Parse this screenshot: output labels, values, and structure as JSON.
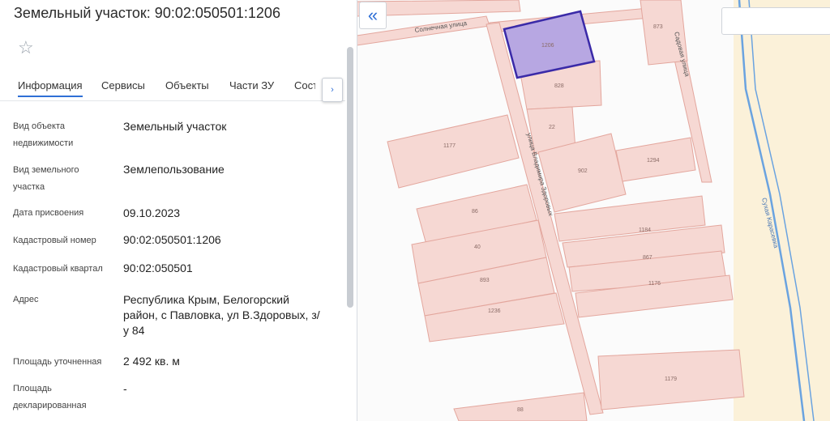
{
  "panel": {
    "title": "Земельный участок: 90:02:050501:1206",
    "star": "☆",
    "tabs": [
      "Информация",
      "Сервисы",
      "Объекты",
      "Части ЗУ",
      "Соста"
    ],
    "tab_scroll_icon": "›",
    "fields": [
      {
        "label": [
          "Вид объекта",
          "недвижимости"
        ],
        "value": [
          "Земельный участок"
        ]
      },
      {
        "label": [
          "Вид земельного",
          "участка"
        ],
        "value": [
          "Землепользование"
        ]
      },
      {
        "label": [
          "Дата присвоения"
        ],
        "value": [
          "09.10.2023"
        ]
      },
      {
        "label": [
          "Кадастровый номер"
        ],
        "value": [
          "90:02:050501:1206"
        ]
      },
      {
        "label": [
          "Кадастровый квартал"
        ],
        "value": [
          "90:02:050501"
        ]
      },
      {
        "label": [
          "Адрес"
        ],
        "value": [
          "Республика Крым, Белогорский",
          "район, с Павловка, ул В.Здоровых, з/",
          "у 84"
        ]
      },
      {
        "label": [
          "Площадь уточненная"
        ],
        "value": [
          "2 492 кв. м"
        ]
      },
      {
        "label": [
          "Площадь",
          "декларированная"
        ],
        "value": [
          "-"
        ]
      }
    ]
  },
  "map": {
    "collapse_icon": "«",
    "streets": [
      "Солнечная улица",
      "Садовая улица",
      "улица Владимира Здоровых",
      "Сухая Карасевка"
    ],
    "parcels": [
      "1206",
      "828",
      "873",
      "22",
      "1177",
      "902",
      "1294",
      "86",
      "1184",
      "40",
      "867",
      "893",
      "1176",
      "1236",
      "1179",
      "88"
    ],
    "colors": {
      "parcel_fill": "#f6d8d3",
      "parcel_stroke": "#e3a69d",
      "selected_fill": "#b7a7e2",
      "selected_stroke": "#3a2aa8",
      "river": "#6aa3e0",
      "field": "#fbf1d9"
    }
  }
}
